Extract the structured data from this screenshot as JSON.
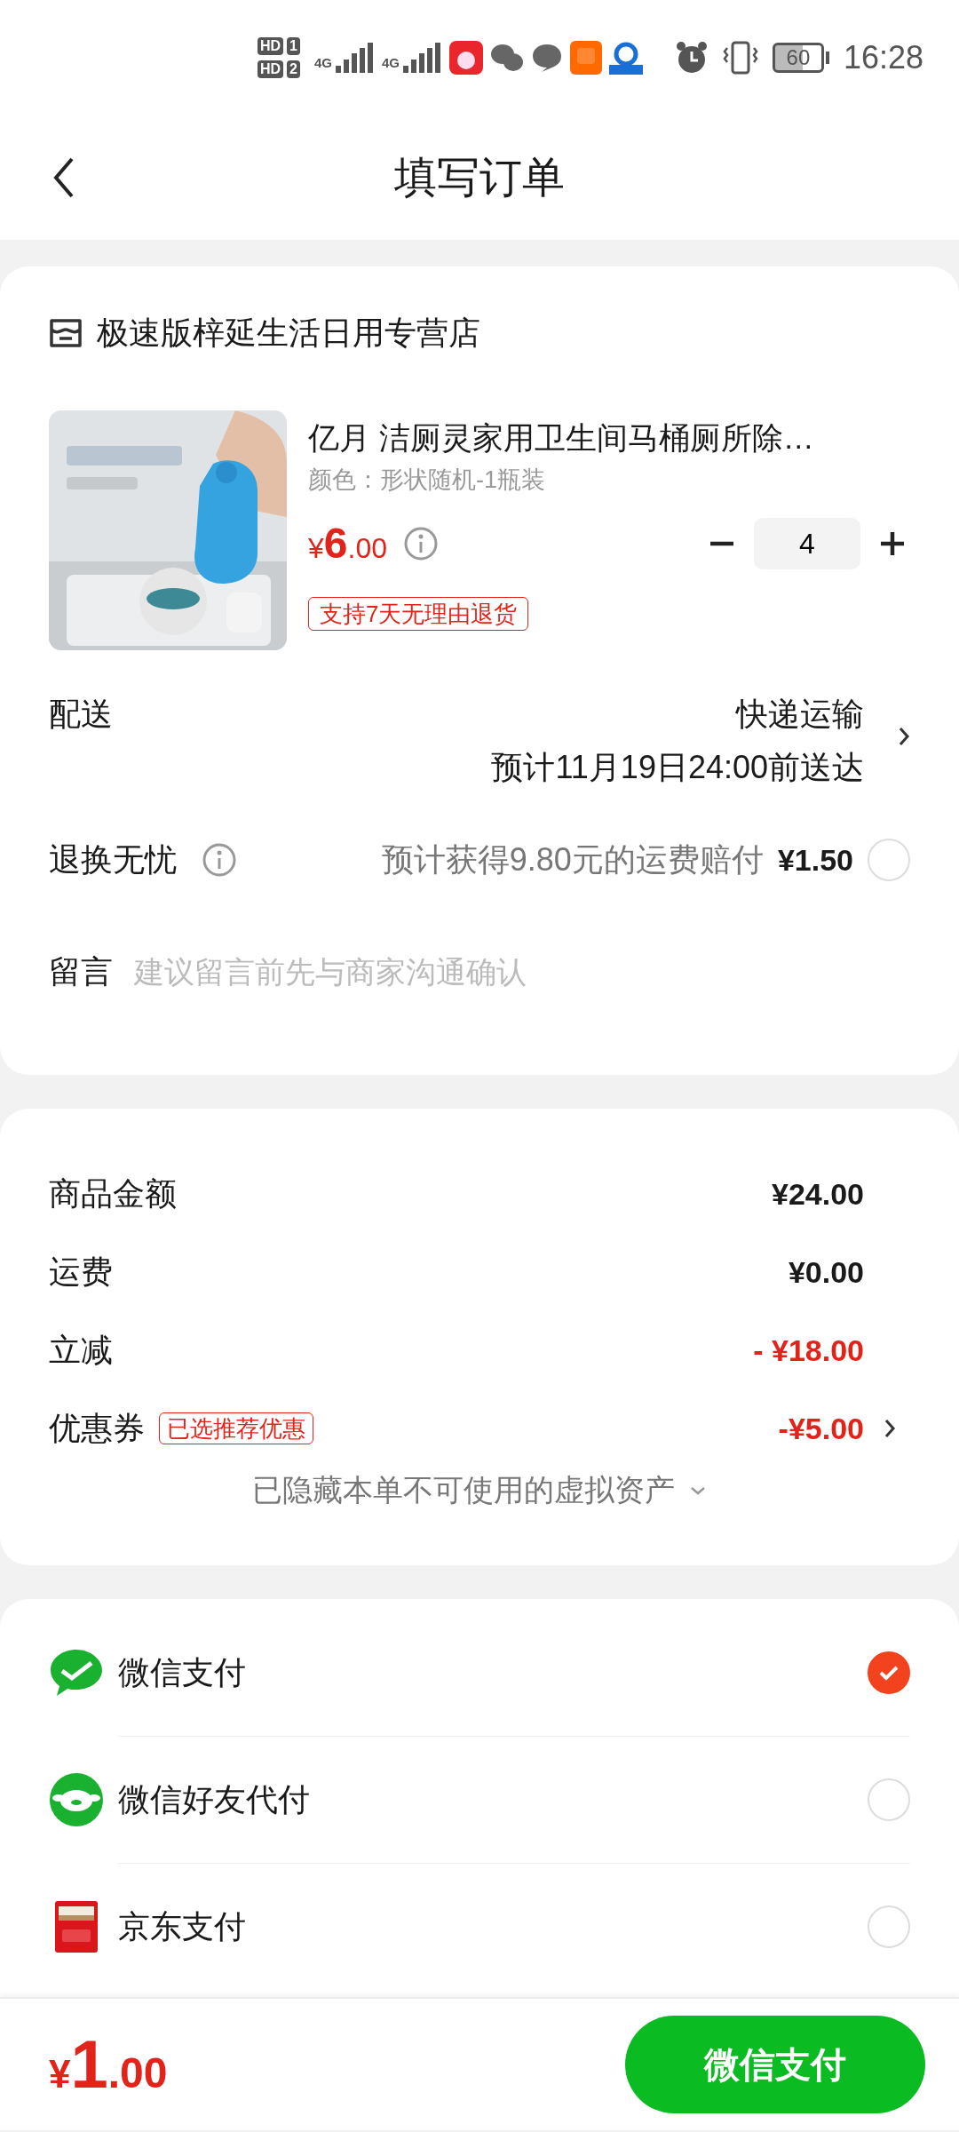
{
  "status_bar": {
    "sims": [
      {
        "label": "HD",
        "slot": "1"
      },
      {
        "label": "HD",
        "slot": "2"
      }
    ],
    "networks": [
      "4G",
      "4G"
    ],
    "battery": "60",
    "time": "16:28"
  },
  "header": {
    "title": "填写订单"
  },
  "store": {
    "name": "极速版梓延生活日用专营店"
  },
  "product": {
    "title": "亿月 洁厕灵家用卫生间马桶厕所除…",
    "spec": "颜色：形状随机-1瓶装",
    "price": {
      "currency": "¥",
      "integer": "6",
      "decimal": ".00"
    },
    "quantity": "4",
    "badge": "支持7天无理由退货"
  },
  "delivery": {
    "label": "配送",
    "method": "快递运输",
    "estimate": "预计11月19日24:00前送达"
  },
  "return_insurance": {
    "label": "退换无忧",
    "description": "预计获得9.80元的运费赔付",
    "price": "¥1.50",
    "checked": false
  },
  "message": {
    "label": "留言",
    "placeholder": "建议留言前先与商家沟通确认"
  },
  "summary": {
    "rows": [
      {
        "label": "商品金额",
        "value": "¥24.00",
        "kind": "normal"
      },
      {
        "label": "运费",
        "value": "¥0.00",
        "kind": "normal"
      },
      {
        "label": "立减",
        "value": "- ¥18.00",
        "kind": "discount"
      },
      {
        "label": "优惠券",
        "tag": "已选推荐优惠",
        "value": "-¥5.00",
        "kind": "discount",
        "chevron": true
      }
    ],
    "hidden_note": "已隐藏本单不可使用的虚拟资产"
  },
  "payment_methods": [
    {
      "name": "微信支付",
      "kind": "wechat",
      "selected": true
    },
    {
      "name": "微信好友代付",
      "kind": "friend",
      "selected": false
    },
    {
      "name": "京东支付",
      "kind": "jd",
      "selected": false
    }
  ],
  "footer": {
    "total": {
      "currency": "¥",
      "integer": "1",
      "decimal": ".00"
    },
    "pay_button": "微信支付"
  }
}
